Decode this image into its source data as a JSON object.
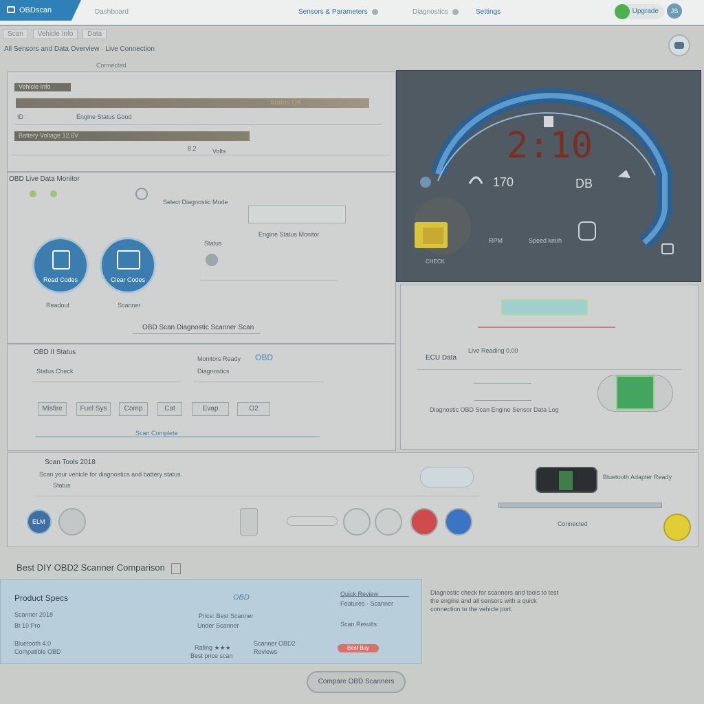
{
  "top_bar": {
    "tab_label": "OBDscan",
    "faint_label": "Dashboard",
    "link1": "Sensors & Parameters",
    "link2": "Diagnostics",
    "link3": "Settings",
    "user_label": "Upgrade",
    "avatar_initials": "JS"
  },
  "breadcrumb": [
    "Scan",
    "Vehicle Info",
    "Data"
  ],
  "subtitle": "All Sensors and Data Overview · Live Connection",
  "subline": "Connected",
  "vehicle_panel": {
    "tag": "Vehicle Info",
    "bar_label": "Status OK",
    "row1_left": "ID",
    "row1_mid": "Engine Status Good",
    "row2_left": "Battery Voltage 12.6V",
    "row2_mid": "8.2",
    "row2_right": "Volts"
  },
  "gauge": {
    "digits": "2:10",
    "left_val": "170",
    "right_val": "DB",
    "foot_left": "RPM",
    "foot_mid": "Speed km/h",
    "warn_label": "CHECK",
    "colors": {
      "ring": "#3f86c4",
      "digits": "#7a2f22",
      "panel": "#4f5a62",
      "warn": "#d8c53a"
    }
  },
  "controls": {
    "title": "OBD Live Data Monitor",
    "link": "Engine Status Monitor",
    "sub": "Status",
    "field_hint": "Select Diagnostic Mode",
    "button1": "Read Codes",
    "button2": "Clear Codes",
    "caption1": "Readout",
    "caption2": "Scanner",
    "footer_link": "OBD Scan Diagnostic Scanner Scan"
  },
  "readiness": {
    "title": "OBD II Status",
    "label1": "Status Check",
    "label2": "Monitors Ready",
    "value2": "OBD",
    "value2b": "Diagnostics",
    "chips": [
      "Misfire",
      "Fuel Sys",
      "Comp",
      "Cat",
      "Evap",
      "O2"
    ],
    "foot": "Scan Complete"
  },
  "reading_panel": {
    "label": "ECU Data",
    "sub": "Live Reading 0.00",
    "desc": "Diagnostic OBD Scan Engine Sensor Data Log"
  },
  "tools": {
    "title": "Scan Tools 2018",
    "desc": "Scan your vehicle for diagnostics and battery status.",
    "sub": "Status",
    "slider_label": "Connected",
    "logo_text": "ELM",
    "side_label": "Bluetooth Adapter Ready"
  },
  "section_title": "Best DIY OBD2 Scanner Comparison",
  "product": {
    "title": "Product Specs",
    "l1": "Scanner 2018",
    "l2": "Bt 10 Pro",
    "l3": "Bluetooth 4.0",
    "l4": "Compatible OBD",
    "m_logo": "OBD",
    "m1": "Price: Best Scanner",
    "m2": "Under Scanner",
    "m3": "Rating ★★★",
    "m4": "Best price scan",
    "m5": "Scanner OBD2",
    "m6": "Reviews",
    "r1": "Quick Review",
    "r2": "Features · Scanner",
    "r3": "Scan Results",
    "badge": "Best Buy"
  },
  "side_text": "Diagnostic check for scanners and tools to test the engine and all sensors with a quick connection to the vehicle port.",
  "bottom_button": "Compare OBD Scanners"
}
